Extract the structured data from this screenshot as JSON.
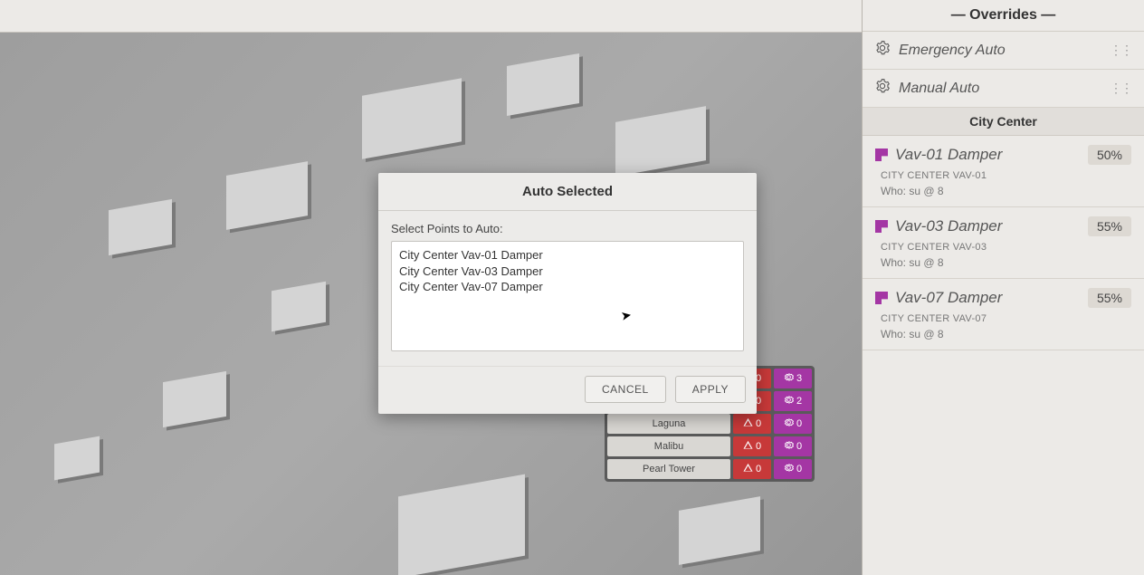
{
  "sidebar": {
    "title": "— Overrides —",
    "autoRows": [
      {
        "label": "Emergency Auto"
      },
      {
        "label": "Manual Auto"
      }
    ],
    "section": "City Center",
    "overrides": [
      {
        "name": "Vav-01 Damper",
        "badge": "50%",
        "sub1": "CITY CENTER VAV-01",
        "sub2": "Who: su @ 8"
      },
      {
        "name": "Vav-03 Damper",
        "badge": "55%",
        "sub1": "CITY CENTER VAV-03",
        "sub2": "Who: su @ 8"
      },
      {
        "name": "Vav-07 Damper",
        "badge": "55%",
        "sub1": "CITY CENTER VAV-07",
        "sub2": "Who: su @ 8"
      }
    ]
  },
  "modal": {
    "title": "Auto Selected",
    "prompt": "Select Points to Auto:",
    "points": [
      "City Center Vav-01 Damper",
      "City Center Vav-03 Damper",
      "City Center Vav-07 Damper"
    ],
    "cancel": "CANCEL",
    "apply": "APPLY"
  },
  "buildings": [
    {
      "name": "",
      "alarms": "0",
      "overrides": "3"
    },
    {
      "name": "",
      "alarms": "0",
      "overrides": "2"
    },
    {
      "name": "Laguna",
      "alarms": "0",
      "overrides": "0"
    },
    {
      "name": "Malibu",
      "alarms": "0",
      "overrides": "0"
    },
    {
      "name": "Pearl Tower",
      "alarms": "0",
      "overrides": "0"
    }
  ]
}
